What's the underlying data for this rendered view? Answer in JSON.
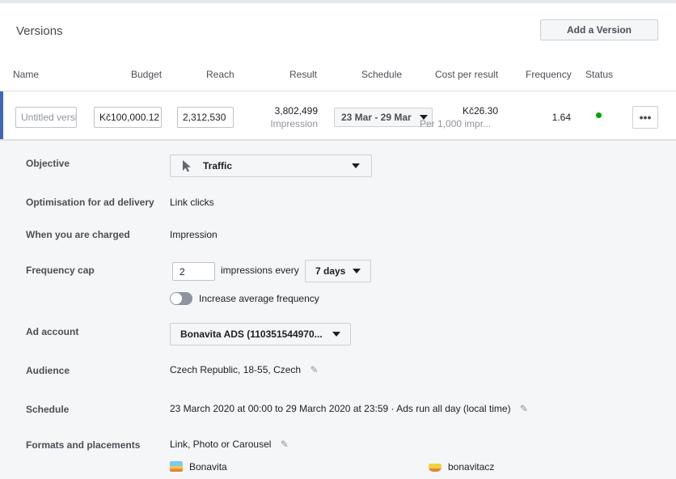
{
  "header": {
    "title": "Versions",
    "add_version_label": "Add a Version"
  },
  "table": {
    "columns": [
      "Name",
      "Budget",
      "Reach",
      "Result",
      "Schedule",
      "Cost per result",
      "Frequency",
      "Status"
    ],
    "row": {
      "name_placeholder": "Untitled version",
      "budget": "Kč100,000.12",
      "reach": "2,312,530",
      "result_value": "3,802,499",
      "result_type": "Impression",
      "schedule": "23 Mar - 29 Mar",
      "cost_value": "Kč26.30",
      "cost_subtext": "Per 1,000 impr...",
      "frequency": "1.64",
      "status_color": "#00a400"
    }
  },
  "details": {
    "objective": {
      "label": "Objective",
      "value": "Traffic",
      "icon": "cursor-icon"
    },
    "optimisation": {
      "label": "Optimisation for ad delivery",
      "value": "Link clicks"
    },
    "charged": {
      "label": "When you are charged",
      "value": "Impression"
    },
    "frequency_cap": {
      "label": "Frequency cap",
      "value": "2",
      "middle_text": "impressions every",
      "period": "7 days",
      "toggle_label": "Increase average frequency"
    },
    "ad_account": {
      "label": "Ad account",
      "value": "Bonavita ADS (110351544970..."
    },
    "audience": {
      "label": "Audience",
      "value": "Czech Republic, 18-55, Czech"
    },
    "schedule": {
      "label": "Schedule",
      "value": "23 March 2020 at 00:00 to 29 March 2020 at 23:59 · Ads run all day (local time)"
    },
    "formats": {
      "label": "Formats and placements",
      "value": "Link, Photo or Carousel",
      "pages": [
        "Bonavita",
        "bonavitacz"
      ]
    }
  },
  "colors": {
    "accent": "#4267b2",
    "panel_bg": "#f5f6f7"
  }
}
